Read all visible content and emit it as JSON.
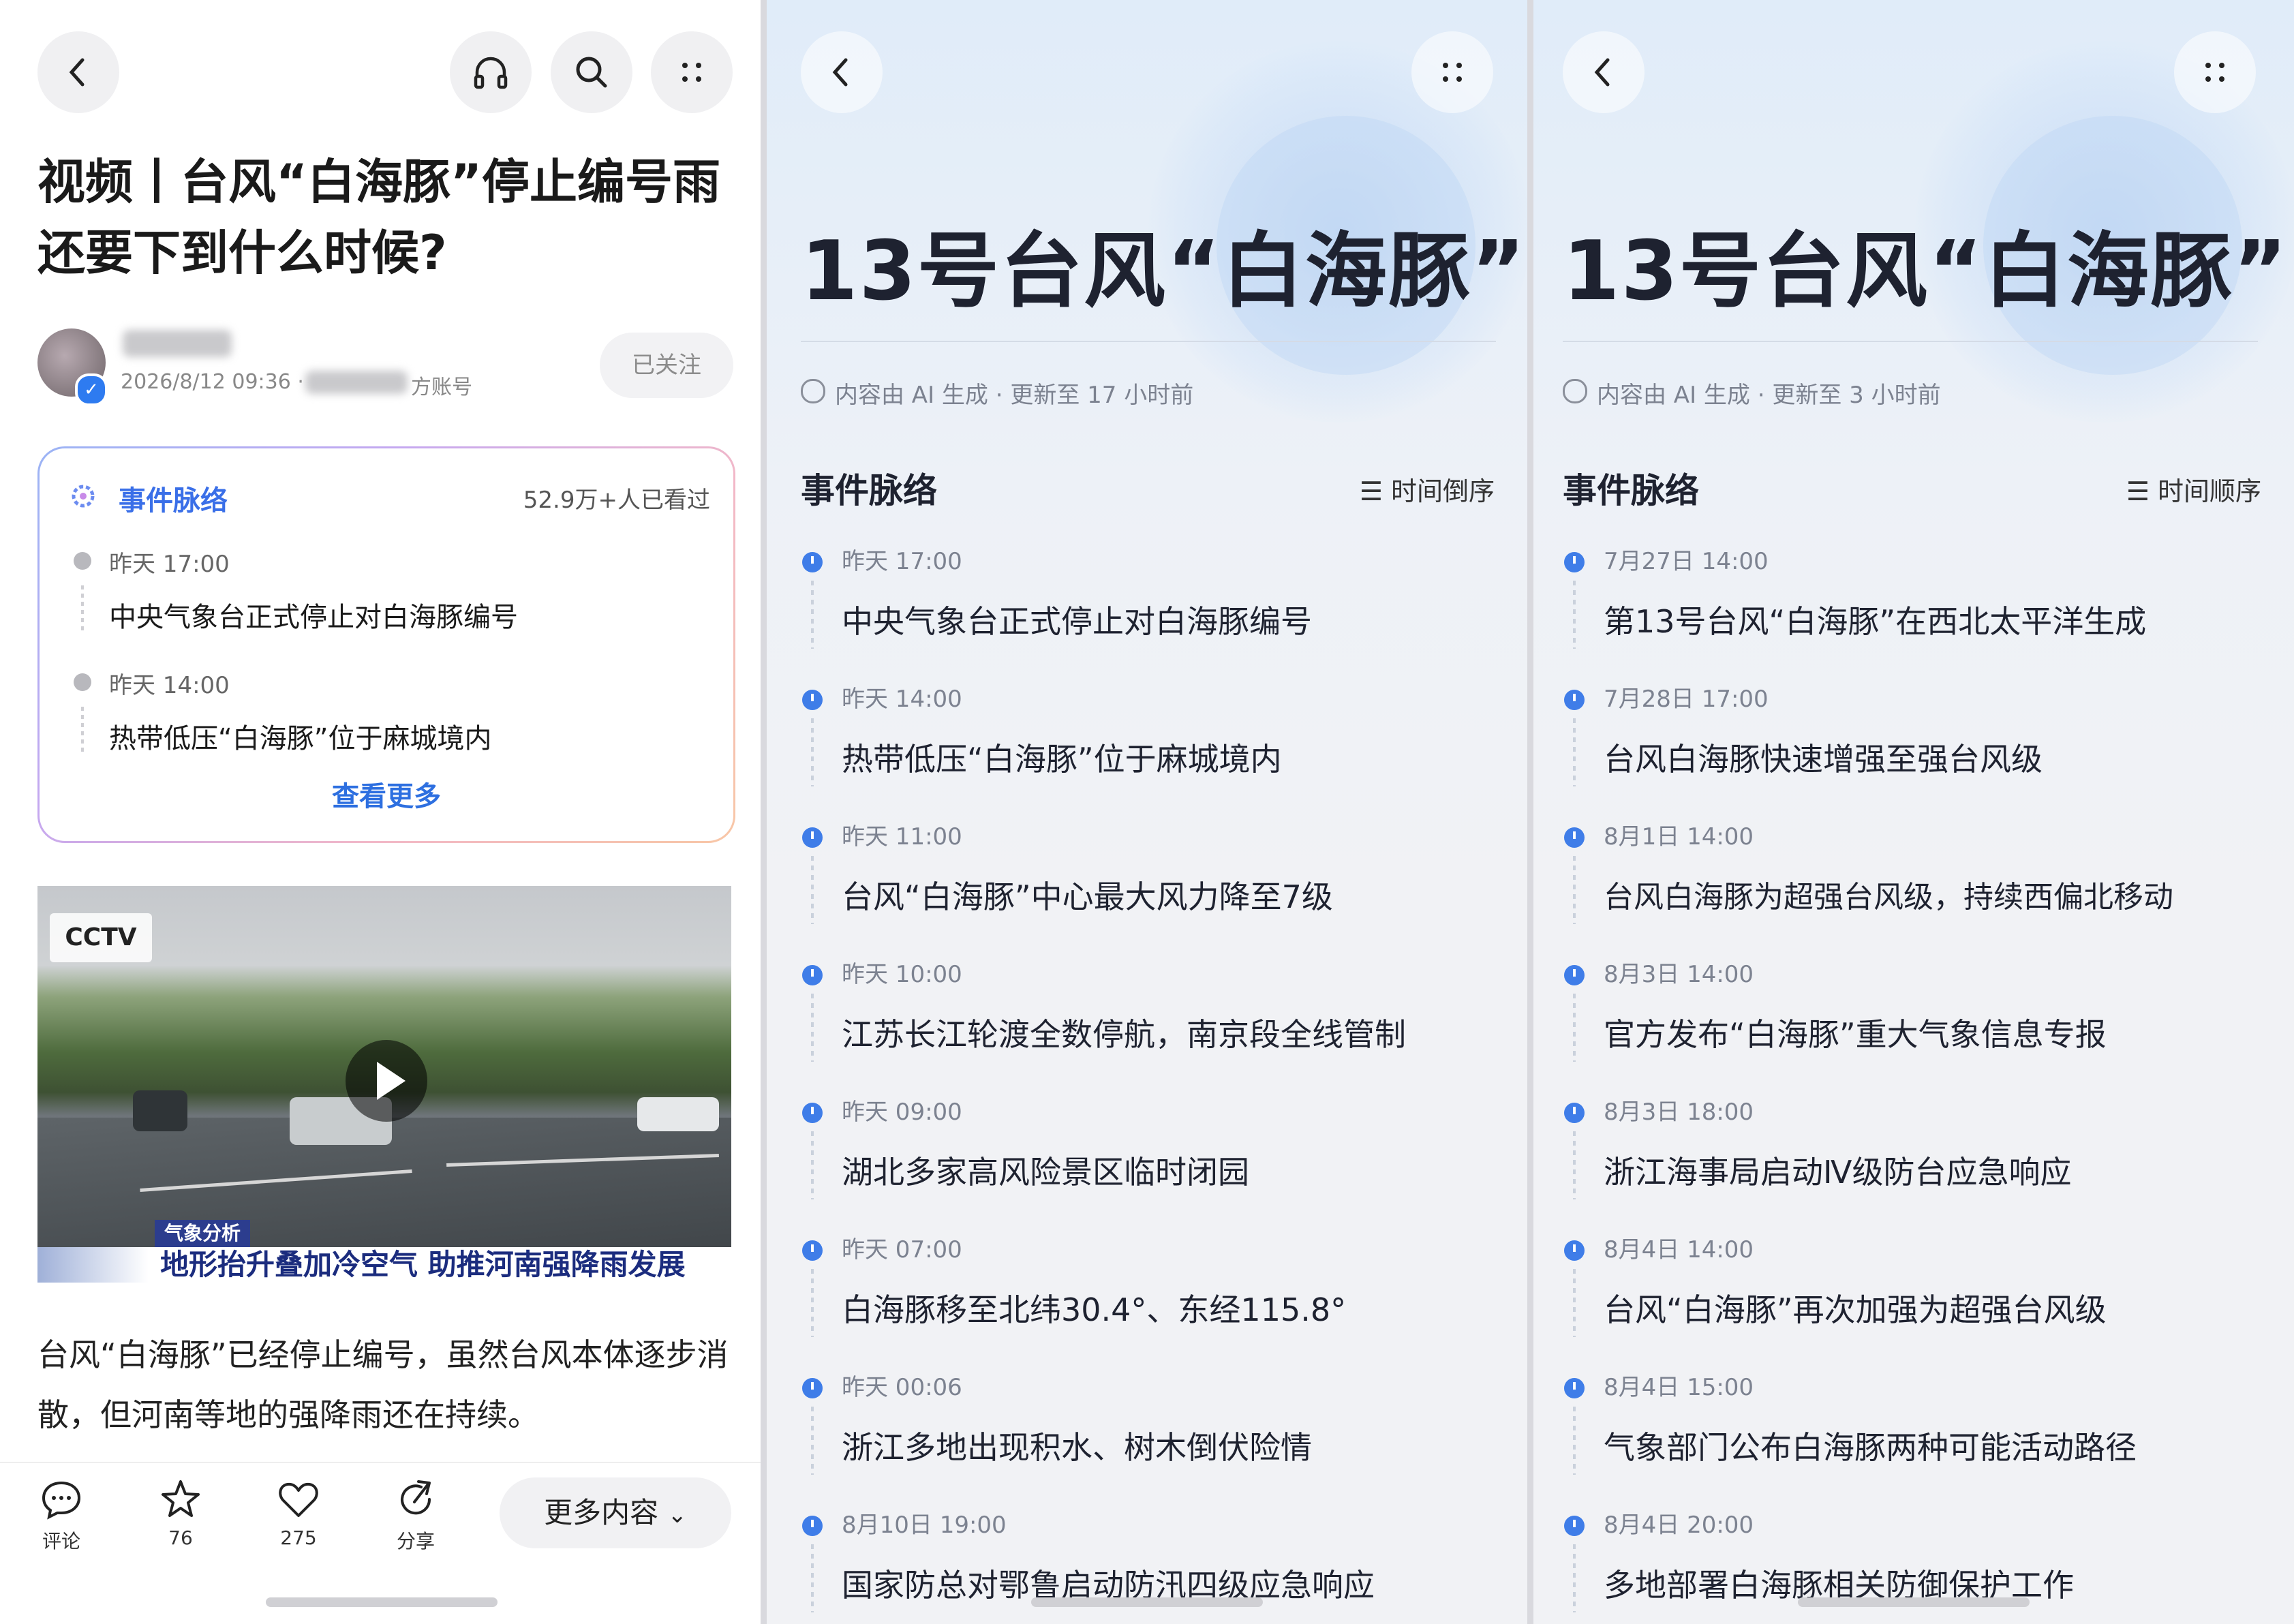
{
  "panel1": {
    "title": "视频丨台风“白海豚”停止编号雨还要下到什么时候?",
    "author": {
      "date": "2026/8/12 09:36 ·",
      "account_suffix": "方账号"
    },
    "follow_label": "已关注",
    "event_card": {
      "header": "事件脉络",
      "views": "52.9万+人已看过",
      "items": [
        {
          "time": "昨天 17:00",
          "text": "中央气象台正式停止对白海豚编号"
        },
        {
          "time": "昨天 14:00",
          "text": "热带低压“白海豚”位于麻城境内"
        }
      ],
      "more": "查看更多"
    },
    "video": {
      "logo": "CCTV",
      "tag": "气象分析",
      "caption": "地形抬升叠加冷空气 助推河南强降雨发展"
    },
    "body_text": "台风“白海豚”已经停止编号，虽然台风本体逐步消散，但河南等地的强降雨还在持续。",
    "bottom_bar": {
      "comment_label": "评论",
      "star_count": "76",
      "like_count": "275",
      "share_label": "分享",
      "more_label": "更多内容"
    }
  },
  "panel2": {
    "title": "13号台风“白海豚”",
    "ai_info": "内容由 AI 生成 · 更新至 17 小时前",
    "section": "事件脉络",
    "order_label": "时间倒序",
    "items": [
      {
        "time": "昨天 17:00",
        "text": "中央气象台正式停止对白海豚编号"
      },
      {
        "time": "昨天 14:00",
        "text": "热带低压“白海豚”位于麻城境内"
      },
      {
        "time": "昨天 11:00",
        "text": "台风“白海豚”中心最大风力降至7级"
      },
      {
        "time": "昨天 10:00",
        "text": "江苏长江轮渡全数停航，南京段全线管制"
      },
      {
        "time": "昨天 09:00",
        "text": "湖北多家高风险景区临时闭园"
      },
      {
        "time": "昨天 07:00",
        "text": "白海豚移至北纬30.4°、东经115.8°"
      },
      {
        "time": "昨天 00:06",
        "text": "浙江多地出现积水、树木倒伏险情"
      },
      {
        "time": "8月10日 19:00",
        "text": "国家防总对鄂鲁启动防汛四级应急响应"
      }
    ]
  },
  "panel3": {
    "title": "13号台风“白海豚”",
    "ai_info": "内容由 AI 生成 · 更新至 3 小时前",
    "section": "事件脉络",
    "order_label": "时间顺序",
    "items": [
      {
        "time": "7月27日 14:00",
        "text": "第13号台风“白海豚”在西北太平洋生成"
      },
      {
        "time": "7月28日 17:00",
        "text": "台风白海豚快速增强至强台风级"
      },
      {
        "time": "8月1日 14:00",
        "text": "台风白海豚为超强台风级，持续西偏北移动"
      },
      {
        "time": "8月3日 14:00",
        "text": "官方发布“白海豚”重大气象信息专报"
      },
      {
        "time": "8月3日 18:00",
        "text": "浙江海事局启动Ⅳ级防台应急响应"
      },
      {
        "time": "8月4日 14:00",
        "text": "台风“白海豚”再次加强为超强台风级"
      },
      {
        "time": "8月4日 15:00",
        "text": "气象部门公布白海豚两种可能活动路径"
      },
      {
        "time": "8月4日 20:00",
        "text": "多地部署白海豚相关防御保护工作"
      }
    ]
  },
  "colors": {
    "accent": "#3f7de8",
    "link": "#2d6fe0",
    "title": "#1e2230"
  }
}
